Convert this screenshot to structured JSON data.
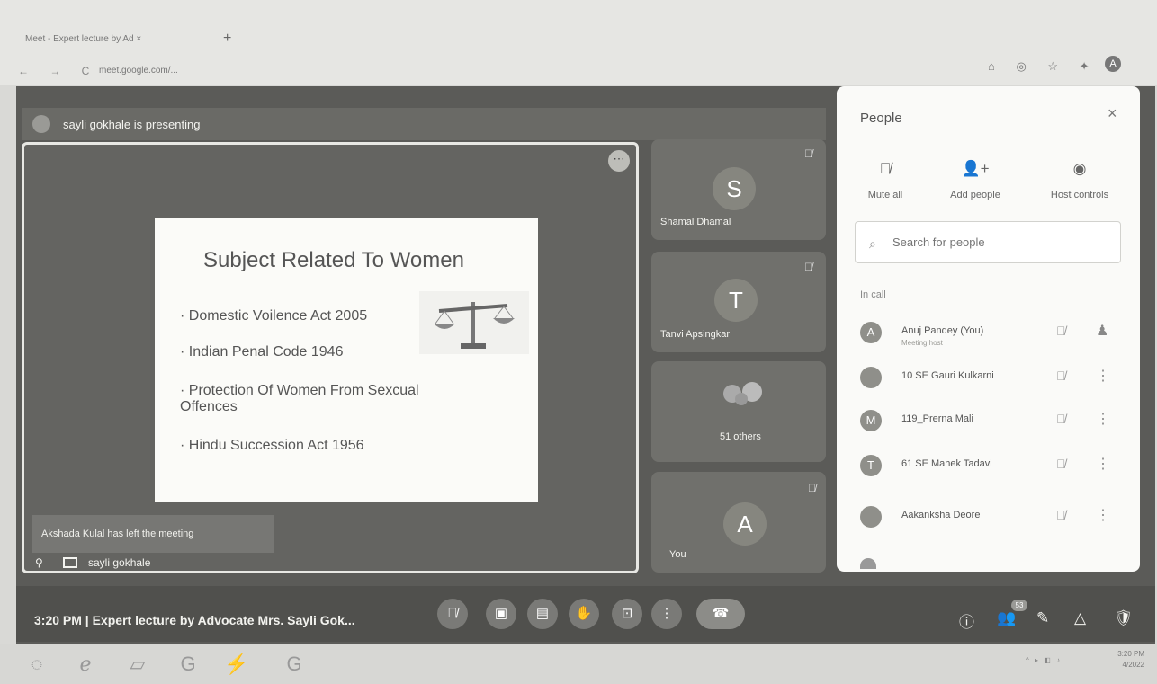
{
  "browser": {
    "tab_title": "Meet - Expert lecture by Ad",
    "tab_close": "×",
    "new_tab": "+",
    "nav": "← → C",
    "url": "meet.google.com/...",
    "icons": "⌂ ◎ ☆ ✦",
    "profile": "A"
  },
  "meet": {
    "presenting": "sayli gokhale is presenting",
    "more_options": "⋯",
    "slide": {
      "title": "Subject Related To  Women",
      "bullets": [
        "Domestic Voilence Act 2005",
        "Indian Penal Code 1946",
        "Protection Of Women From Sexcual Offences",
        "Hindu Succession Act 1956"
      ]
    },
    "toast": "Akshada Kulal has left the meeting",
    "presenter": "sayli gokhale",
    "tiles": [
      {
        "initial": "S",
        "name": "Shamal Dhamal"
      },
      {
        "initial": "T",
        "name": "Tanvi Apsingkar"
      },
      {
        "initial": "",
        "name": "51 others"
      },
      {
        "initial": "A",
        "name": "You"
      }
    ],
    "people_panel": {
      "title": "People",
      "close": "×",
      "actions": [
        {
          "icon": "🎙̸",
          "label": "Mute all"
        },
        {
          "icon": "👤+",
          "label": "Add people"
        },
        {
          "icon": "◉",
          "label": "Host controls"
        }
      ],
      "search_placeholder": "Search for people",
      "section": "In call",
      "people": [
        {
          "initial": "A",
          "name": "Anuj Pandey (You)",
          "sub": "Meeting host",
          "action": "♟"
        },
        {
          "initial": "",
          "name": "10 SE Gauri Kulkarni",
          "sub": "",
          "action": "⋮"
        },
        {
          "initial": "M",
          "name": "119_Prerna Mali",
          "sub": "",
          "action": "⋮"
        },
        {
          "initial": "T",
          "name": "61 SE Mahek Tadavi",
          "sub": "",
          "action": "⋮"
        },
        {
          "initial": "",
          "name": "Aakanksha Deore",
          "sub": "",
          "action": "⋮"
        }
      ]
    },
    "meeting_info": "3:20 PM  |  Expert lecture by Advocate Mrs. Sayli Gok...",
    "controls": [
      "🎙̸",
      "▣",
      "▤",
      "✋",
      "⊡",
      "⋮",
      "☎"
    ],
    "right_controls": [
      "ⓘ",
      "👥",
      "✎",
      "△",
      "🛡"
    ],
    "participant_badge": "53"
  },
  "taskbar": {
    "icons": [
      "◌",
      "ℯ",
      "▱",
      "G",
      "⚡",
      "G"
    ],
    "tray": "^ ▸ ◧ ♪",
    "time": "3:20 PM",
    "date": "4/2022"
  }
}
